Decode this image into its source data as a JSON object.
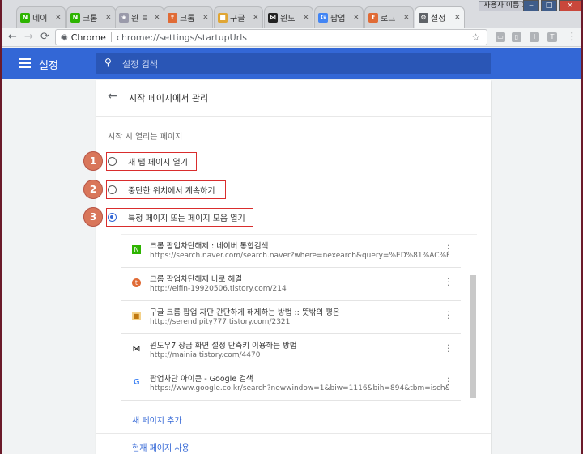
{
  "browser": {
    "tabs": [
      {
        "label": "네이",
        "favicon": "naver-icon",
        "color": "#2db400",
        "glyph": "N"
      },
      {
        "label": "크롬",
        "favicon": "naver-icon",
        "color": "#2db400",
        "glyph": "N"
      },
      {
        "label": "윈 ㅌ",
        "favicon": "star-icon",
        "color": "#9a9aaa",
        "glyph": "★"
      },
      {
        "label": "크롬",
        "favicon": "tistory-icon",
        "color": "#e06b36",
        "glyph": "t"
      },
      {
        "label": "구글",
        "favicon": "bookmark-icon",
        "color": "#e0a635",
        "glyph": "■"
      },
      {
        "label": "윈도",
        "favicon": "butterfly-icon",
        "color": "#222222",
        "glyph": "⋈"
      },
      {
        "label": "팝업",
        "favicon": "google-icon",
        "color": "#4285f4",
        "glyph": "G"
      },
      {
        "label": "로그",
        "favicon": "tistory-icon",
        "color": "#e06b36",
        "glyph": "t"
      },
      {
        "label": "설정",
        "favicon": "gear-icon",
        "color": "#5f6368",
        "glyph": "⚙"
      }
    ],
    "close_glyph": "×",
    "profile_label": "사용자 이름 1",
    "omnibox": {
      "site_label": "Chrome",
      "url": "chrome://settings/startupUrls"
    }
  },
  "settings": {
    "header_title": "설정",
    "search_placeholder": "설정 검색",
    "subpage_title": "시작 페이지에서 관리",
    "section_label": "시작 시 열리는 페이지",
    "options": [
      {
        "label": "새 탭 페이지 열기",
        "checked": false,
        "marker": "1"
      },
      {
        "label": "중단한 위치에서 계속하기",
        "checked": false,
        "marker": "2"
      },
      {
        "label": "특정 페이지 또는 페이지 모음 열기",
        "checked": true,
        "marker": "3"
      }
    ],
    "pages": [
      {
        "title": "크롬 팝업차단해제 : 네이버 통합검색",
        "url": "https://search.naver.com/search.naver?where=nexearch&query=%ED%81%AC%EB...",
        "icon": "naver-icon"
      },
      {
        "title": "크롬 팝업차단해제 바로 해결",
        "url": "http://elfin-19920506.tistory.com/214",
        "icon": "tistory-icon"
      },
      {
        "title": "구글 크롬 팝업 자단 간단하게 해제하는 방법 :: 뜻밖의 평온",
        "url": "http://serendipity777.tistory.com/2321",
        "icon": "bookmark-icon"
      },
      {
        "title": "윈도우7 장금 화면 설정 단축키 이용하는 방법",
        "url": "http://mainia.tistory.com/4470",
        "icon": "butterfly-icon"
      },
      {
        "title": "팝업차단 아이콘 - Google 검색",
        "url": "https://www.google.co.kr/search?newwindow=1&biw=1116&bih=894&tbm=isch&...",
        "icon": "google-icon"
      }
    ],
    "add_page_link": "새 페이지 추가",
    "use_current_link": "현재 페이지 사용"
  }
}
